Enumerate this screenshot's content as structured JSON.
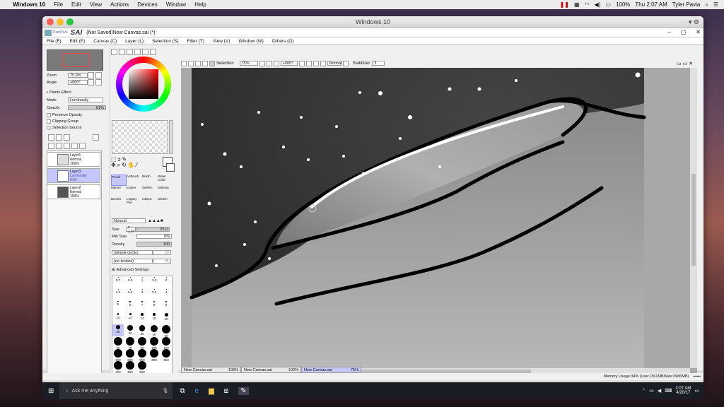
{
  "mac_menubar": {
    "app": "Windows 10",
    "menus": [
      "File",
      "Edit",
      "View",
      "Actions",
      "Devices",
      "Window",
      "Help"
    ],
    "battery": "100%",
    "clock": "Thu 2:07 AM",
    "user": "Tyler Pavia"
  },
  "mac_window": {
    "title": "Windows 10"
  },
  "sai": {
    "logo": "SAI",
    "logo_sub": "PaintTool",
    "doc_title": "(Not Saved)New Canvas.sai (*)",
    "menu": [
      "File (F)",
      "Edit (E)",
      "Canvas (C)",
      "Layer (L)",
      "Selection (S)",
      "Filter (T)",
      "View (V)",
      "Window (W)",
      "Others (O)"
    ],
    "navigator": {
      "zoom_label": "Zoom",
      "zoom_value": "75.0%",
      "angle_label": "Angle",
      "angle_value": "+000°"
    },
    "layer_panel": {
      "paper_effect": "Paints Effect",
      "mode_label": "Mode",
      "mode_value": "Luminosity",
      "opacity_label": "Opacity",
      "opacity_value": "81%",
      "preserve": "Preserve Opacity",
      "clipping": "Clipping Group",
      "selection_source": "Selection Source",
      "layers": [
        {
          "name": "Layer1",
          "mode": "Normal",
          "opacity": "100%"
        },
        {
          "name": "Layer3",
          "mode": "Luminosity",
          "opacity": "81%"
        },
        {
          "name": "Layer2",
          "mode": "Normal",
          "opacity": "100%"
        }
      ]
    },
    "tools": [
      [
        "Pencil",
        "AirBrush",
        "Brush",
        "Water Color"
      ],
      [
        "Marker",
        "Eraser",
        "SelPen",
        "SelEras"
      ],
      [
        "Bucket",
        "Legacy Pen",
        "Inkpen",
        "Sketch"
      ]
    ],
    "brush": {
      "blend": "Normal",
      "size_label": "Size",
      "size_mult": "x 1.0",
      "size_value": "25.0",
      "minsize_label": "Min Size",
      "minsize_value": "0%",
      "density_label": "Density",
      "density_value": "100",
      "shape": "(simple circle)",
      "shape_val": "50",
      "texture": "(no texture)",
      "texture_val": "95",
      "advanced": "Advanced Settings",
      "sizes": [
        "0.7",
        "0.8",
        "1",
        "1.5",
        "2",
        "2.3",
        "2.6",
        "3",
        "3.5",
        "4",
        "5",
        "6",
        "7",
        "8",
        "9",
        "10",
        "12",
        "14",
        "16",
        "20",
        "25",
        "30",
        "35",
        "40",
        "50",
        "60",
        "70",
        "80",
        "100",
        "120",
        "160",
        "200",
        "250",
        "300",
        "350",
        "400",
        "450",
        "500"
      ]
    },
    "canvas_toolbar": {
      "selection": "Selection",
      "zoom": "75%",
      "angle": "+000°",
      "blend": "Normal",
      "stabilizer_label": "Stabilizer",
      "stabilizer_value": "3"
    },
    "tabs": [
      {
        "name": "New Canvas.sai",
        "zoom": "100%"
      },
      {
        "name": "New Canvas.sai",
        "zoom": "100%"
      },
      {
        "name": "New Canvas.sai",
        "zoom": "75%"
      }
    ],
    "status": "Memory Usage:34% (Use:1361MB/Max:3986MB)"
  },
  "taskbar": {
    "search_placeholder": "Ask me anything",
    "time": "2:07 AM",
    "date": "4/20/17"
  }
}
